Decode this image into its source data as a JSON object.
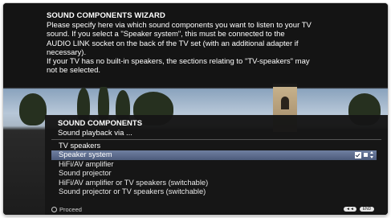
{
  "help": {
    "title": "SOUND COMPONENTS WIZARD",
    "lines": [
      "Please specify here via which sound components you want to listen to your TV",
      "sound. If you select a \"Speaker system\", this must be connected to the",
      "AUDIO LINK socket on the back of the TV set (with an additional adapter if",
      "necessary).",
      "If your TV has no built-in speakers, the sections relating to \"TV-speakers\" may",
      "not be selected."
    ]
  },
  "menu": {
    "title": "SOUND COMPONENTS",
    "subtitle": "Sound playback via ...",
    "items": [
      {
        "label": "TV speakers"
      },
      {
        "label": "Speaker system"
      },
      {
        "label": "HiFi/AV amplifier"
      },
      {
        "label": "Sound projector"
      },
      {
        "label": "HiFi/AV amplifier or TV speakers (switchable)"
      },
      {
        "label": "Sound projector or TV speakers (switchable)"
      }
    ],
    "selected_index": 1
  },
  "footer": {
    "proceed_label": "Proceed",
    "back_label": "◄◄",
    "exit_label": "END"
  },
  "icons": {
    "checkbox": "checkbox-checked-icon",
    "speaker": "speaker-icon",
    "updown": "up-down-arrows-icon",
    "ok": "ok-circle-icon"
  },
  "colors": {
    "selection": "#5e6e8e",
    "panel": "#161616",
    "text": "#ffffff"
  }
}
